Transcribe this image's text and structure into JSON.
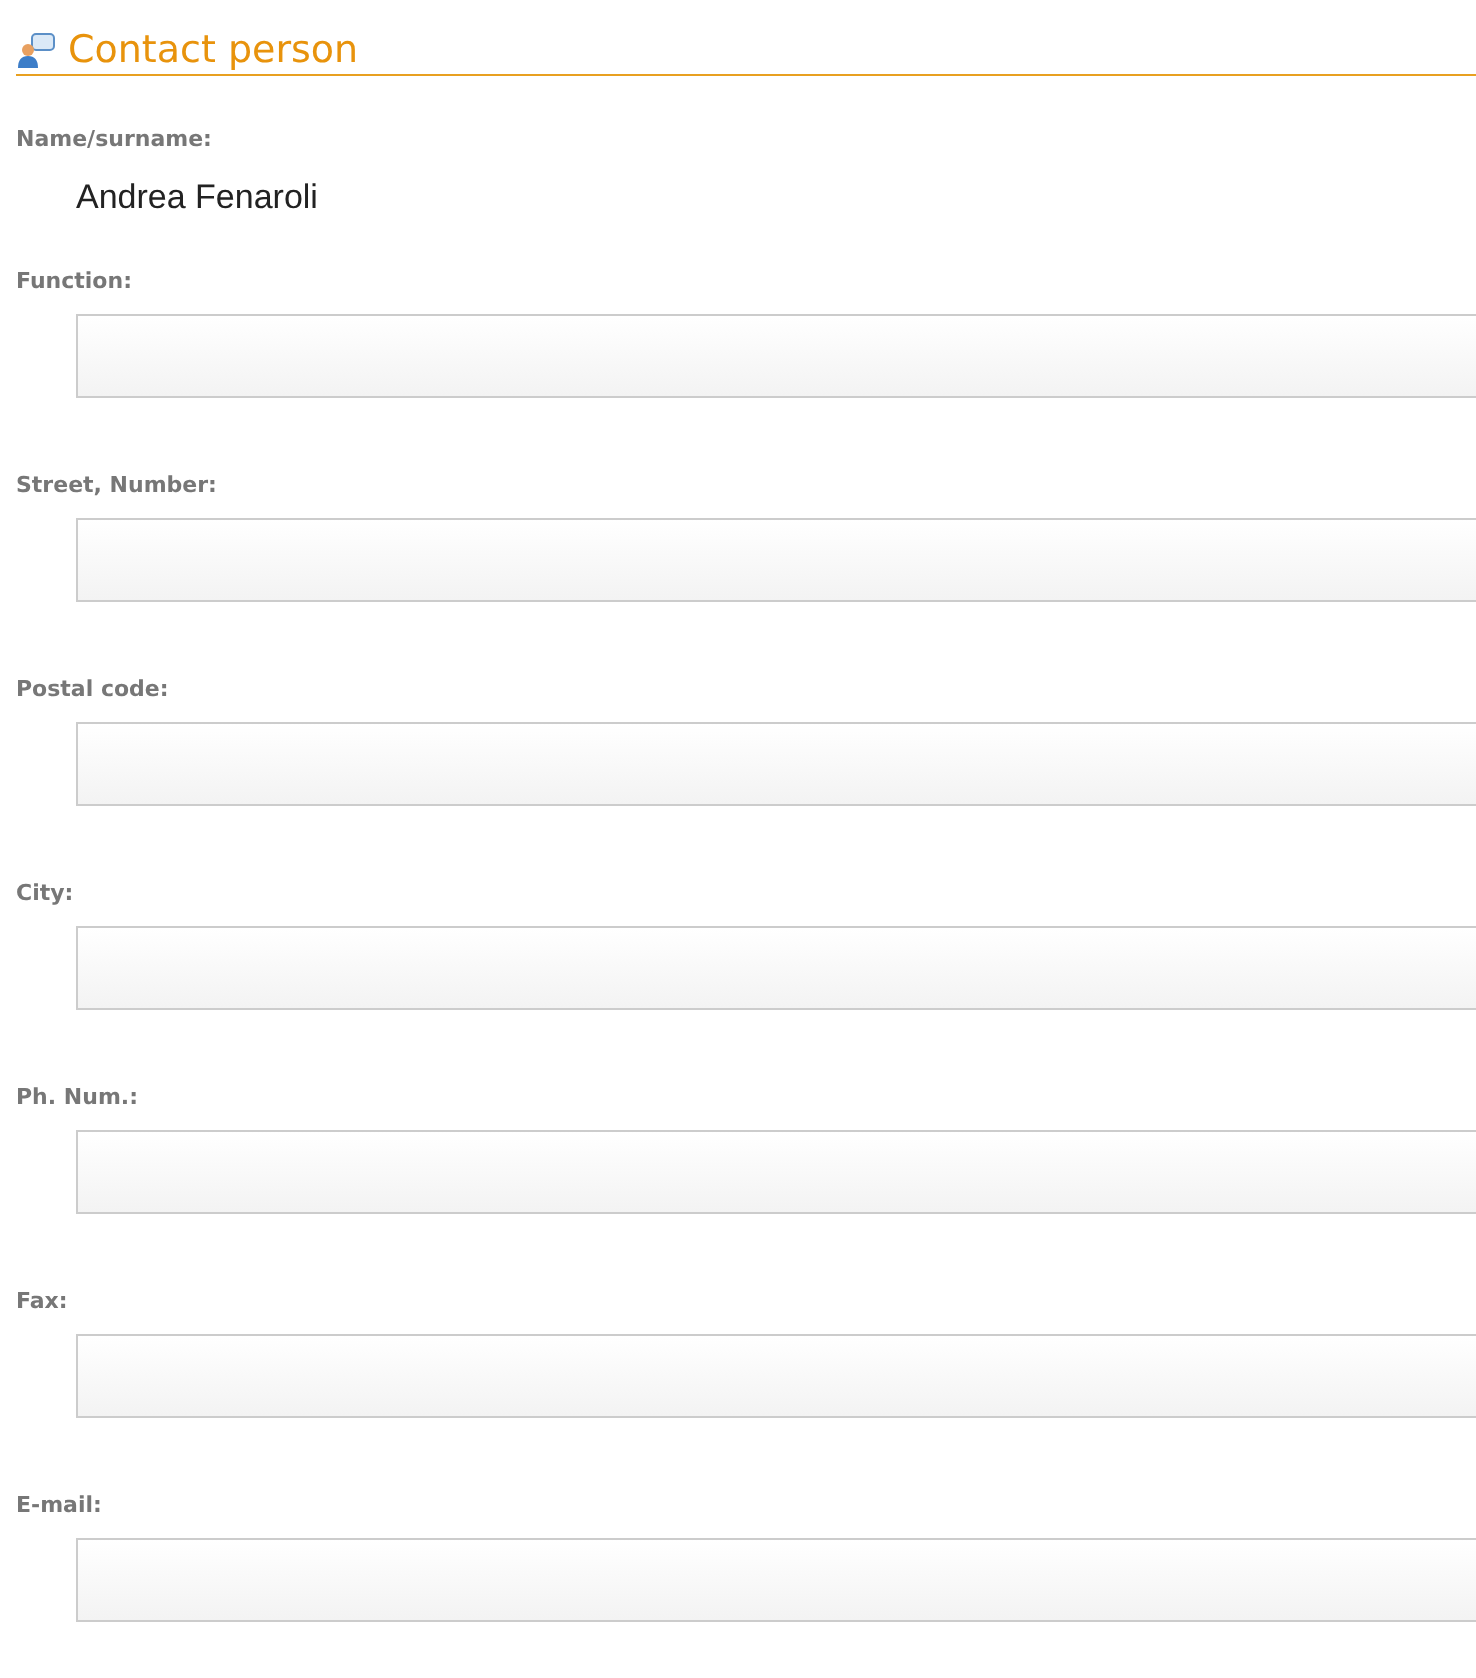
{
  "section": {
    "title": "Contact person"
  },
  "name": {
    "label": "Name/surname:",
    "value": "Andrea Fenaroli"
  },
  "fields": [
    {
      "label": "Function:"
    },
    {
      "label": "Street, Number:"
    },
    {
      "label": "Postal code:"
    },
    {
      "label": "City:"
    },
    {
      "label": "Ph. Num.:"
    },
    {
      "label": "Fax:"
    },
    {
      "label": "E-mail:"
    }
  ]
}
